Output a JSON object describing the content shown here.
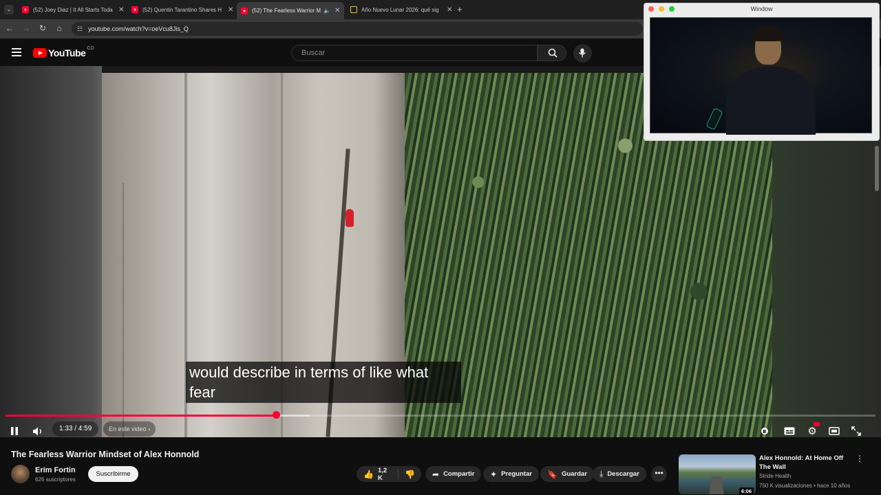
{
  "browser": {
    "tabs": [
      {
        "label": "(52) Joey Diaz | It All Starts Toda",
        "icon": "youtube-favicon"
      },
      {
        "label": "(52) Quentin Tarantino Shares H",
        "icon": "youtube-favicon"
      },
      {
        "label": "(52) The Fearless Warrior Mi",
        "icon": "youtube-favicon",
        "active": true
      },
      {
        "label": "Año Nuevo Lunar 2026: qué sig",
        "icon": "document-favicon"
      }
    ],
    "new_tab": "+",
    "url": "youtube.com/watch?v=oeVcu8Jis_Q"
  },
  "youtube": {
    "logo_text": "YouTube",
    "logo_country": "CO",
    "search_placeholder": "Buscar"
  },
  "player": {
    "caption_line1": "would describe in terms of like what",
    "caption_line2": "fear",
    "time": "1:33 / 4:59",
    "chapter_label": "En este video",
    "progress": 0.311,
    "buffered": 0.35,
    "accent": "#ff0033"
  },
  "floating_window": {
    "title": "Window"
  },
  "video": {
    "title": "The Fearless Warrior Mindset of Alex Honnold",
    "channel": "Erim Fortin",
    "subscribers": "626 suscriptores",
    "subscribe_label": "Suscribirme",
    "likes": "1,2 K",
    "share_label": "Compartir",
    "ask_label": "Preguntar",
    "save_label": "Guardar",
    "download_label": "Descargar"
  },
  "recommendation": {
    "title": "Alex Honnold: At Home Off The Wall",
    "channel": "Stride Health",
    "meta": "750 K visualizaciones • hace 10 años",
    "duration": "6:06"
  }
}
